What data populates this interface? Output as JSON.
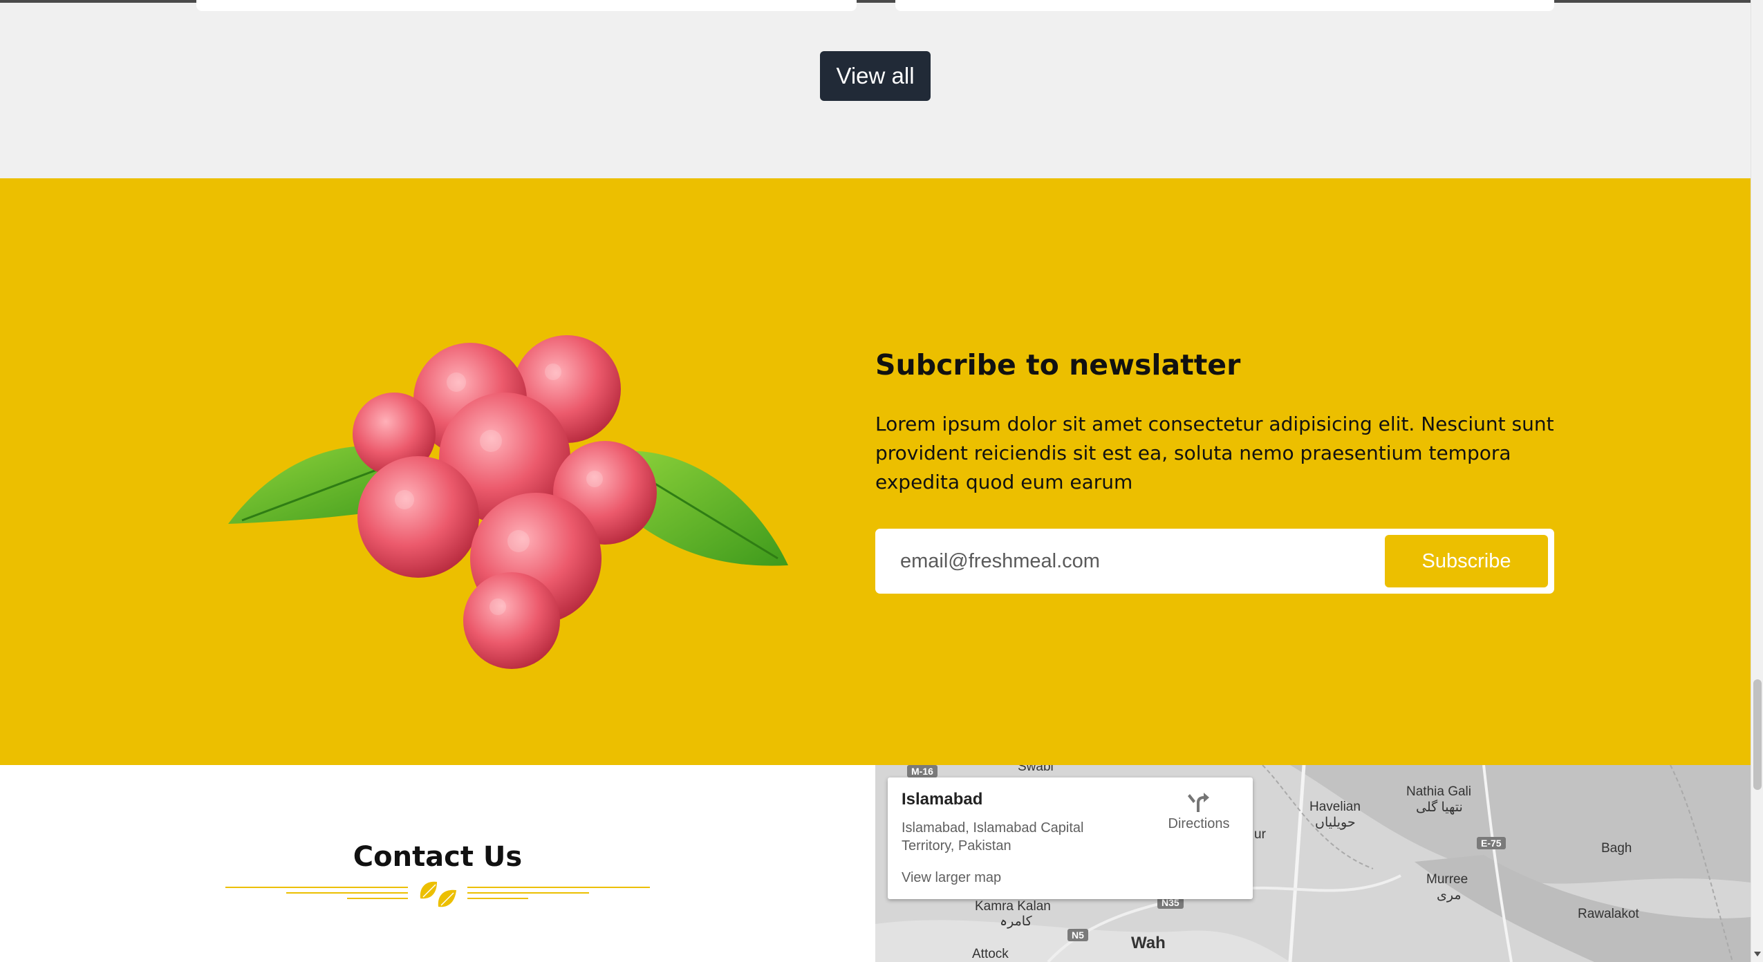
{
  "view_all": {
    "label": "View all"
  },
  "newsletter": {
    "title": "Subcribe to newslatter",
    "text": "Lorem ipsum dolor sit amet consectetur adipisicing elit. Nesciunt sunt provident reiciendis sit est ea, soluta nemo praesentium tempora expedita quod eum earum",
    "email_placeholder": "email@freshmeal.com",
    "email_value": "",
    "subscribe_label": "Subscribe",
    "image": "raspberries-with-leaves"
  },
  "contact": {
    "title": "Contact Us",
    "ornament_icon": "leaf-icon"
  },
  "map": {
    "place": "Islamabad",
    "address": "Islamabad, Islamabad Capital Territory, Pakistan",
    "directions_label": "Directions",
    "view_larger_label": "View larger map",
    "labels": [
      "Swabi",
      "Havelian",
      "حویلیاں",
      "Nathia Gali",
      "نتھیا گلی",
      "Bagh",
      "Murree",
      "مری",
      "Rawalakot",
      "Kamra Kalan",
      "کامرہ",
      "Wah",
      "Attock",
      "ur"
    ],
    "road_badges": [
      "M-16",
      "N35",
      "N5",
      "E-75"
    ]
  },
  "colors": {
    "accent_yellow": "#ecbf00",
    "dark_button": "#212a37",
    "page_bg": "#f0f0f0"
  }
}
